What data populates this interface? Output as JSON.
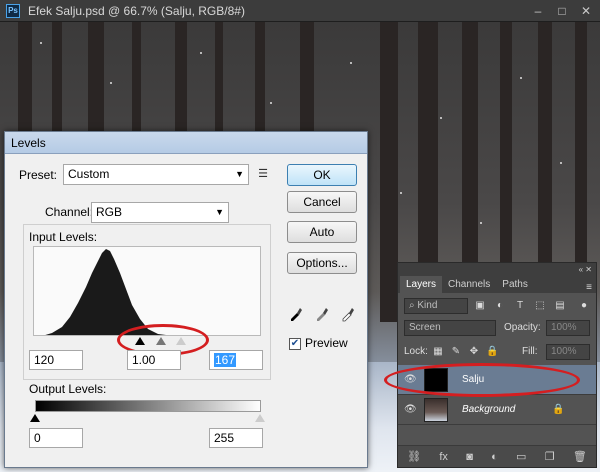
{
  "window": {
    "app_icon": "Ps",
    "title": "Efek Salju.psd @ 66.7% (Salju, RGB/8#)",
    "controls": [
      "–",
      "□",
      "✕"
    ]
  },
  "levels_dialog": {
    "title": "Levels",
    "preset_label": "Preset:",
    "preset_value": "Custom",
    "channel_label": "Channel:",
    "channel_value": "RGB",
    "input_levels_label": "Input Levels:",
    "input_black": "120",
    "input_gamma": "1.00",
    "input_white": "167",
    "output_levels_label": "Output Levels:",
    "output_black": "0",
    "output_white": "255",
    "buttons": {
      "ok": "OK",
      "cancel": "Cancel",
      "auto": "Auto",
      "options": "Options..."
    },
    "preview_label": "Preview",
    "preview_checked": true,
    "preset_menu_icon": "list-options-icon",
    "eyedroppers": [
      "black-eyedropper-icon",
      "gray-eyedropper-icon",
      "white-eyedropper-icon"
    ]
  },
  "layers_panel": {
    "tabs": [
      "Layers",
      "Channels",
      "Paths"
    ],
    "active_tab": "Layers",
    "kind_label": "Kind",
    "blend_mode": "Screen",
    "opacity_label": "Opacity:",
    "opacity_value": "100%",
    "lock_label": "Lock:",
    "fill_label": "Fill:",
    "fill_value": "100%",
    "layers": [
      {
        "name": "Salju",
        "selected": true,
        "visible": true
      },
      {
        "name": "Background",
        "selected": false,
        "visible": true,
        "locked": true
      }
    ],
    "bottom_icons": [
      "link-icon",
      "fx-icon",
      "mask-icon",
      "adjustment-icon",
      "folder-icon",
      "new-layer-icon",
      "trash-icon"
    ]
  },
  "annotations": {
    "color": "#d41e20"
  }
}
